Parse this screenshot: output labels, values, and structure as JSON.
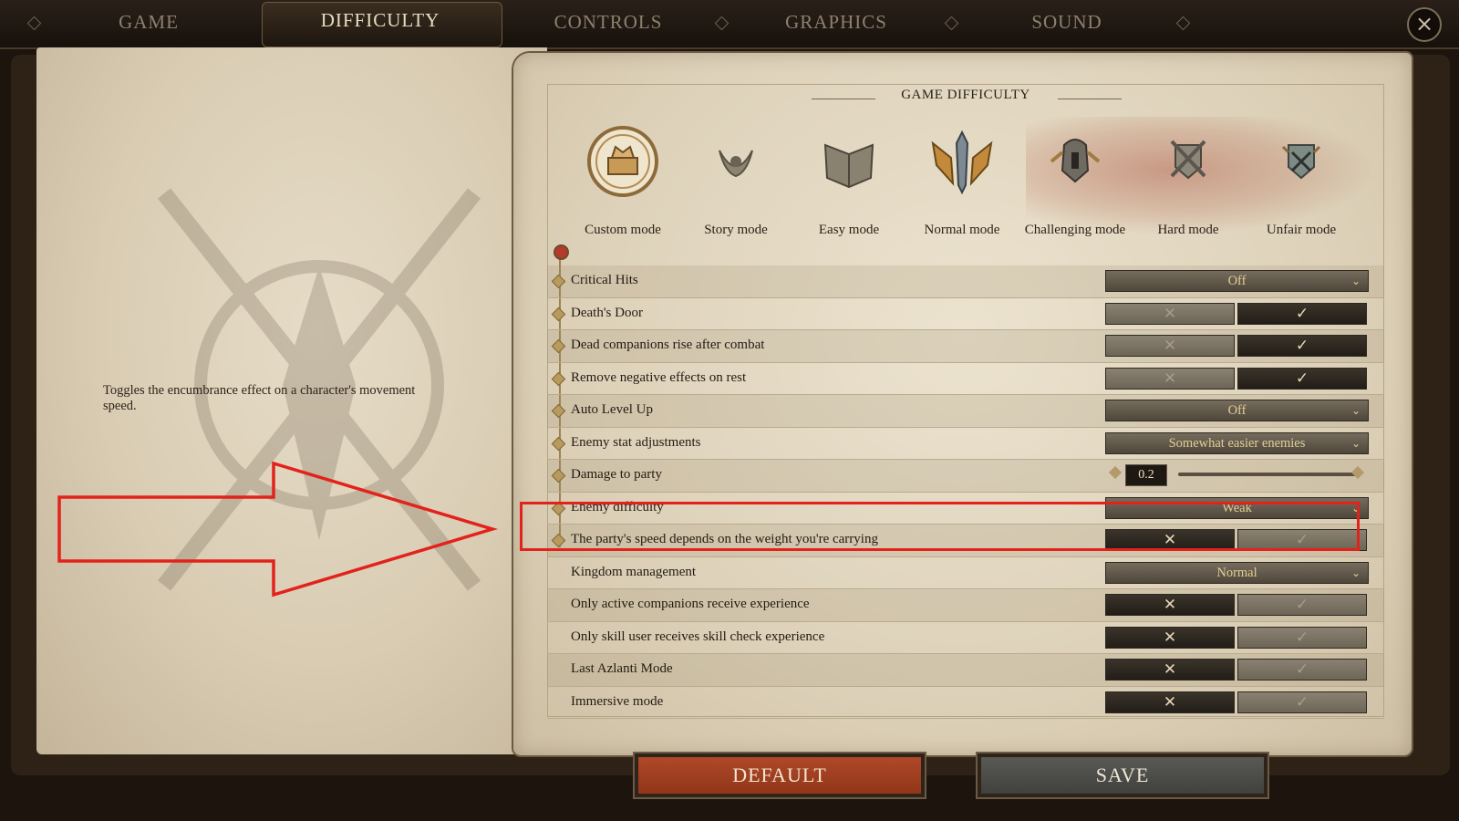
{
  "nav": {
    "tabs": [
      "GAME",
      "DIFFICULTY",
      "CONTROLS",
      "GRAPHICS",
      "SOUND"
    ],
    "active_tab": "DIFFICULTY",
    "close_icon": "close-icon"
  },
  "left_page": {
    "tooltip": "Toggles the encumbrance effect on a character's movement speed."
  },
  "panel": {
    "title": "GAME DIFFICULTY",
    "modes": [
      {
        "label": "Custom mode",
        "icon": "custom-mode-icon",
        "selected": true
      },
      {
        "label": "Story mode",
        "icon": "story-mode-icon"
      },
      {
        "label": "Easy mode",
        "icon": "easy-mode-icon"
      },
      {
        "label": "Normal mode",
        "icon": "normal-mode-icon"
      },
      {
        "label": "Challenging mode",
        "icon": "challenging-mode-icon"
      },
      {
        "label": "Hard mode",
        "icon": "hard-mode-icon"
      },
      {
        "label": "Unfair mode",
        "icon": "unfair-mode-icon"
      }
    ],
    "settings": [
      {
        "label": "Critical Hits",
        "type": "dropdown",
        "value": "Off"
      },
      {
        "label": "Death's Door",
        "type": "toggle",
        "value": true
      },
      {
        "label": "Dead companions rise after combat",
        "type": "toggle",
        "value": true
      },
      {
        "label": "Remove negative effects on rest",
        "type": "toggle",
        "value": true
      },
      {
        "label": "Auto Level Up",
        "type": "dropdown",
        "value": "Off"
      },
      {
        "label": "Enemy stat adjustments",
        "type": "dropdown",
        "value": "Somewhat easier enemies"
      },
      {
        "label": "Damage to party",
        "type": "slider",
        "value": "0.2"
      },
      {
        "label": "Enemy difficulty",
        "type": "dropdown",
        "value": "Weak"
      },
      {
        "label": "The party's speed depends on the weight you're carrying",
        "type": "toggle",
        "value": false
      },
      {
        "label": "Kingdom management",
        "type": "dropdown",
        "value": "Normal"
      },
      {
        "label": "Only active companions receive experience",
        "type": "toggle",
        "value": false
      },
      {
        "label": "Only skill user receives skill check experience",
        "type": "toggle",
        "value": false
      },
      {
        "label": "Last Azlanti Mode",
        "type": "toggle",
        "value": false
      },
      {
        "label": "Immersive mode",
        "type": "toggle",
        "value": false
      }
    ],
    "toggle_off_glyph": "✕",
    "toggle_on_glyph": "✓",
    "dropdown_chevron": "⌄"
  },
  "buttons": {
    "default_label": "DEFAULT",
    "save_label": "SAVE"
  },
  "annotation": {
    "highlight_color": "#e2221b"
  }
}
